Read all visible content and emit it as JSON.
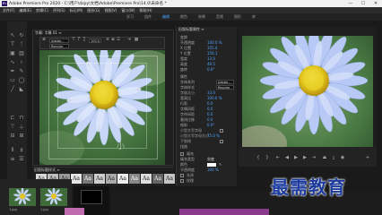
{
  "window": {
    "app_icon": "Pr",
    "title": "Adobe Premiere Pro 2020 - C:\\用户\\dzpy\\文档\\Adobe\\Premiere Pro\\14.0\\未命名 *",
    "buttons": [
      "—",
      "☐",
      "✕"
    ]
  },
  "menu": [
    "文件(F)",
    "编辑(E)",
    "剪辑(C)",
    "序列(S)",
    "标记(M)",
    "图形(G)",
    "视图(V)",
    "窗口(W)",
    "帮助(H)"
  ],
  "workspaces": {
    "tabs": [
      "学习",
      "组件",
      "编辑",
      "颜色",
      "效果",
      "音频",
      "图形",
      "库"
    ],
    "active_index": 2
  },
  "title_panel": {
    "header": "字幕: 字幕 01 ≡",
    "font_value": "Adobe...",
    "style_value": "Regular",
    "size_value": "100.0",
    "canvas_text": "小"
  },
  "styles_panel": {
    "header": "旧版标题样式 ≡",
    "swatches": [
      "Aa",
      "Aa",
      "Aa",
      "Aa",
      "Aa",
      "Aa",
      "Aa",
      "Aa",
      "Aa",
      "Aa",
      "Aa",
      "Aa"
    ]
  },
  "controls_panel": {
    "header": "旧版标题属性 ≡",
    "rows": [
      {
        "label": "变换",
        "value": ""
      },
      {
        "label": "不透明度",
        "value": "100.0 %"
      },
      {
        "label": "X 位置",
        "value": "155.4"
      },
      {
        "label": "Y 位置",
        "value": "156.1"
      },
      {
        "label": "宽度",
        "value": "13.0"
      },
      {
        "label": "高度",
        "value": "49.5"
      },
      {
        "label": "旋转",
        "value": "0.0°"
      },
      {
        "label": "属性",
        "value": ""
      },
      {
        "label": "字体系列",
        "value": ""
      },
      {
        "label": "字体样式",
        "value": ""
      },
      {
        "label": "字体大小",
        "value": "33.0"
      },
      {
        "label": "宽高比",
        "value": "100.0 %"
      },
      {
        "label": "行距",
        "value": "0.0"
      },
      {
        "label": "字偶间距",
        "value": "0.0"
      },
      {
        "label": "字符间距",
        "value": "0.0"
      },
      {
        "label": "基线位移",
        "value": "0.0"
      },
      {
        "label": "倾斜",
        "value": "0.0°"
      },
      {
        "label": "小型大写字母",
        "value": ""
      },
      {
        "label": "小型大写字母大小",
        "value": "75.0 %"
      },
      {
        "label": "下划线",
        "value": ""
      },
      {
        "label": "扭曲",
        "value": ""
      },
      {
        "label": "填充",
        "value": ""
      },
      {
        "label": "填充类型",
        "value": "实底"
      },
      {
        "label": "颜色",
        "value": ""
      },
      {
        "label": "不透明度",
        "value": "100 %"
      },
      {
        "label": "光泽",
        "value": ""
      },
      {
        "label": "纹理",
        "value": ""
      }
    ],
    "font_family_value": "Adobe...",
    "font_style_value": "Regular"
  },
  "project": {
    "clips": [
      {
        "label": "1.jpg"
      },
      {
        "label": "1.jpg"
      }
    ]
  },
  "watermark": "最需教育",
  "colors": {
    "accent": "#4ea3ff",
    "panel": "#232323",
    "clip_pink": "#c06ab0",
    "watermark": "#1e3c9e"
  }
}
